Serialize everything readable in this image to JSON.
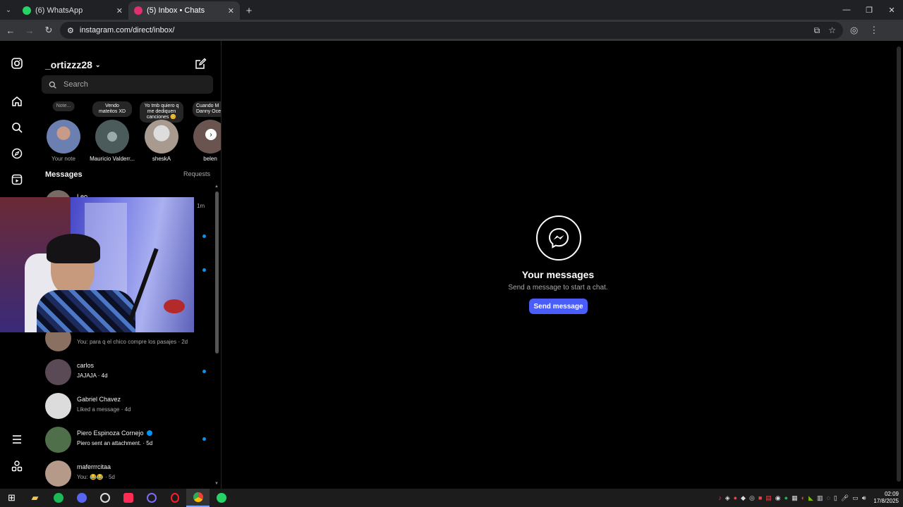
{
  "browser": {
    "tabs": [
      {
        "title": "(6) WhatsApp",
        "favicon_color": "#25d366",
        "active": false
      },
      {
        "title": "(5) Inbox • Chats",
        "favicon_color": "#e1306c",
        "active": true
      }
    ],
    "new_tab_icon": "plus-icon",
    "url": "instagram.com/direct/inbox/"
  },
  "rail": {
    "icons": [
      "instagram-logo-icon",
      "home-icon",
      "search-icon",
      "explore-icon",
      "reels-icon",
      "menu-icon",
      "meta-apps-icon"
    ]
  },
  "inbox": {
    "username": "_ortizzz28",
    "search_placeholder": "Search",
    "notes": [
      {
        "bubble": "Note...",
        "name": "Your note",
        "color": "#6b7fb0"
      },
      {
        "bubble": "Vendo mateitos XD",
        "name": "Mauricio Valderr...",
        "color": "#4b5a5a"
      },
      {
        "bubble": "Yo tmb quiero q me dediquen canciones 😊",
        "name": "sheskA",
        "color": "#a99a8f"
      },
      {
        "bubble": "Cuando M Danny Oce",
        "name": "belen",
        "color": "#6a5450"
      }
    ],
    "messages_title": "Messages",
    "requests_label": "Requests",
    "conversations": [
      {
        "name": "Leo",
        "preview": "",
        "time": "1m",
        "unread": false,
        "verified": false,
        "color": "#7a6a64"
      },
      {
        "name": "",
        "preview": "",
        "time": "",
        "unread": true,
        "verified": false,
        "color": "#333"
      },
      {
        "name": "",
        "preview": "",
        "time": "",
        "unread": true,
        "verified": false,
        "color": "#333"
      },
      {
        "name": "",
        "preview": "You: para q el chico compre los pasajes · 2d",
        "time": "",
        "unread": false,
        "verified": false,
        "color": "#8a7060"
      },
      {
        "name": "carlos",
        "preview": "JAJAJA · 4d",
        "bold": "JAJAJA",
        "time": "",
        "unread": true,
        "verified": false,
        "color": "#5a4a55"
      },
      {
        "name": "Gabriel Chavez",
        "preview": "Liked a message · 4d",
        "time": "",
        "unread": false,
        "verified": false,
        "color": "#dcdcdc"
      },
      {
        "name": "Piero Espinoza Cornejo",
        "preview": "Piero sent an attachment. · 5d",
        "bold": "Piero sent an attachment.",
        "time": "",
        "unread": true,
        "verified": true,
        "color": "#4f6f4a"
      },
      {
        "name": "maferrrcitaa",
        "preview": "You: 😂😂 · 5d",
        "time": "",
        "unread": false,
        "verified": false,
        "color": "#b59a8a"
      }
    ]
  },
  "main": {
    "icon": "messenger-icon",
    "title": "Your messages",
    "subtitle": "Send a message to start a chat.",
    "button": "Send message",
    "button_color": "#4a5df9"
  },
  "taskbar": {
    "apps": [
      "windows-start-icon",
      "file-explorer-icon",
      "spotify-icon",
      "discord-icon",
      "obs-icon",
      "tiktok-icon",
      "opera-gx-icon",
      "opera-icon",
      "chrome-icon",
      "whatsapp-icon"
    ],
    "active_app": "chrome-icon",
    "clock_time": "02:09",
    "clock_date": "17/8/2025"
  }
}
